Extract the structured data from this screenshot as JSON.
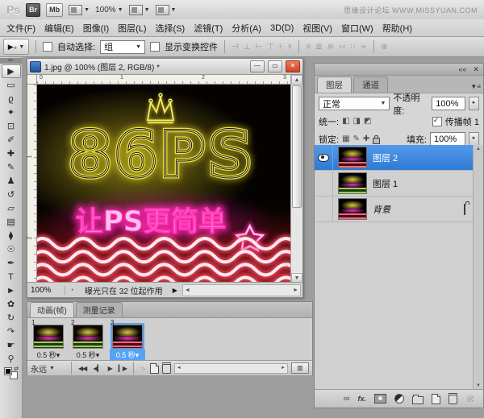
{
  "app_bar": {
    "logo": "Ps",
    "bridge_label": "Br",
    "mini_bridge_label": "Mb",
    "zoom_level": "100%",
    "watermark": "思缘设计论坛 WWW.MISSYUAN.COM"
  },
  "menu_bar": {
    "items": [
      "文件(F)",
      "编辑(E)",
      "图像(I)",
      "图层(L)",
      "选择(S)",
      "滤镜(T)",
      "分析(A)",
      "3D(D)",
      "视图(V)",
      "窗口(W)",
      "帮助(H)"
    ]
  },
  "options_bar": {
    "auto_select_label": "自动选择:",
    "auto_select_value": "组",
    "show_transform_label": "显示变换控件"
  },
  "toolbox": {
    "tools": [
      {
        "name": "move",
        "glyph": "▶"
      },
      {
        "name": "rectangular-marquee",
        "glyph": "▭"
      },
      {
        "name": "lasso",
        "glyph": "ϱ"
      },
      {
        "name": "quick-selection",
        "glyph": "✦"
      },
      {
        "name": "crop",
        "glyph": "⊡"
      },
      {
        "name": "eyedropper",
        "glyph": "✐"
      },
      {
        "name": "spot-healing-brush",
        "glyph": "✚"
      },
      {
        "name": "brush",
        "glyph": "✎"
      },
      {
        "name": "clone-stamp",
        "glyph": "♟"
      },
      {
        "name": "history-brush",
        "glyph": "↺"
      },
      {
        "name": "eraser",
        "glyph": "▱"
      },
      {
        "name": "gradient",
        "glyph": "▤"
      },
      {
        "name": "blur",
        "glyph": "⧫"
      },
      {
        "name": "dodge",
        "glyph": "☉"
      },
      {
        "name": "pen",
        "glyph": "✒"
      },
      {
        "name": "type",
        "glyph": "T"
      },
      {
        "name": "path-selection",
        "glyph": "►"
      },
      {
        "name": "custom-shape",
        "glyph": "✿"
      },
      {
        "name": "3d-rotate",
        "glyph": "↻"
      },
      {
        "name": "3d-orbit",
        "glyph": "↷"
      },
      {
        "name": "hand",
        "glyph": "☛"
      },
      {
        "name": "zoom",
        "glyph": "⚲"
      }
    ]
  },
  "document": {
    "title": "1.jpg @ 100% (图层 2, RGB/8) *",
    "ruler_top": [
      "0",
      "1",
      "2",
      "3"
    ],
    "ruler_left": [
      "1",
      "2"
    ],
    "status": {
      "zoom": "100%",
      "message": "曝光只在 32 位起作用"
    },
    "canvas": {
      "logo_text": "86PS",
      "slogan": "让PS更简单"
    }
  },
  "animation_panel": {
    "tabs": {
      "frames": "动画(帧)",
      "measure": "测量记录"
    },
    "frames": [
      {
        "num": "1",
        "delay": "0.5 秒"
      },
      {
        "num": "2",
        "delay": "0.5 秒"
      },
      {
        "num": "3",
        "delay": "0.5 秒"
      }
    ],
    "loop": "永远"
  },
  "layers_panel": {
    "tabs": {
      "layers": "图层",
      "channels": "通道"
    },
    "blend_mode": "正常",
    "opacity_label": "不透明度:",
    "opacity_value": "100%",
    "unify_label": "统一:",
    "propagate_label": "传播帧 1",
    "lock_label": "锁定:",
    "fill_label": "填充:",
    "fill_value": "100%",
    "fx_label": "fx.",
    "layers": [
      {
        "name": "图层 2"
      },
      {
        "name": "图层 1"
      },
      {
        "name": "背景"
      }
    ]
  }
}
